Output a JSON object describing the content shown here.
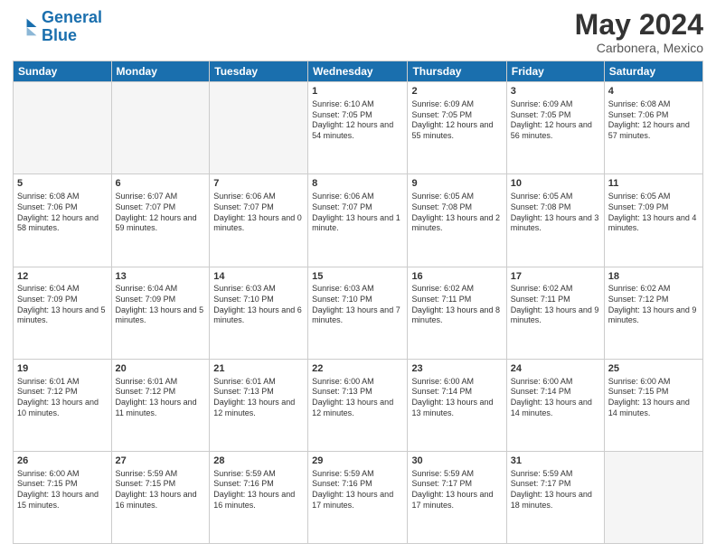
{
  "header": {
    "logo_general": "General",
    "logo_blue": "Blue",
    "month": "May 2024",
    "location": "Carbonera, Mexico"
  },
  "weekdays": [
    "Sunday",
    "Monday",
    "Tuesday",
    "Wednesday",
    "Thursday",
    "Friday",
    "Saturday"
  ],
  "weeks": [
    [
      {
        "day": "",
        "info": ""
      },
      {
        "day": "",
        "info": ""
      },
      {
        "day": "",
        "info": ""
      },
      {
        "day": "1",
        "info": "Sunrise: 6:10 AM\nSunset: 7:05 PM\nDaylight: 12 hours\nand 54 minutes."
      },
      {
        "day": "2",
        "info": "Sunrise: 6:09 AM\nSunset: 7:05 PM\nDaylight: 12 hours\nand 55 minutes."
      },
      {
        "day": "3",
        "info": "Sunrise: 6:09 AM\nSunset: 7:05 PM\nDaylight: 12 hours\nand 56 minutes."
      },
      {
        "day": "4",
        "info": "Sunrise: 6:08 AM\nSunset: 7:06 PM\nDaylight: 12 hours\nand 57 minutes."
      }
    ],
    [
      {
        "day": "5",
        "info": "Sunrise: 6:08 AM\nSunset: 7:06 PM\nDaylight: 12 hours\nand 58 minutes."
      },
      {
        "day": "6",
        "info": "Sunrise: 6:07 AM\nSunset: 7:07 PM\nDaylight: 12 hours\nand 59 minutes."
      },
      {
        "day": "7",
        "info": "Sunrise: 6:06 AM\nSunset: 7:07 PM\nDaylight: 13 hours\nand 0 minutes."
      },
      {
        "day": "8",
        "info": "Sunrise: 6:06 AM\nSunset: 7:07 PM\nDaylight: 13 hours\nand 1 minute."
      },
      {
        "day": "9",
        "info": "Sunrise: 6:05 AM\nSunset: 7:08 PM\nDaylight: 13 hours\nand 2 minutes."
      },
      {
        "day": "10",
        "info": "Sunrise: 6:05 AM\nSunset: 7:08 PM\nDaylight: 13 hours\nand 3 minutes."
      },
      {
        "day": "11",
        "info": "Sunrise: 6:05 AM\nSunset: 7:09 PM\nDaylight: 13 hours\nand 4 minutes."
      }
    ],
    [
      {
        "day": "12",
        "info": "Sunrise: 6:04 AM\nSunset: 7:09 PM\nDaylight: 13 hours\nand 5 minutes."
      },
      {
        "day": "13",
        "info": "Sunrise: 6:04 AM\nSunset: 7:09 PM\nDaylight: 13 hours\nand 5 minutes."
      },
      {
        "day": "14",
        "info": "Sunrise: 6:03 AM\nSunset: 7:10 PM\nDaylight: 13 hours\nand 6 minutes."
      },
      {
        "day": "15",
        "info": "Sunrise: 6:03 AM\nSunset: 7:10 PM\nDaylight: 13 hours\nand 7 minutes."
      },
      {
        "day": "16",
        "info": "Sunrise: 6:02 AM\nSunset: 7:11 PM\nDaylight: 13 hours\nand 8 minutes."
      },
      {
        "day": "17",
        "info": "Sunrise: 6:02 AM\nSunset: 7:11 PM\nDaylight: 13 hours\nand 9 minutes."
      },
      {
        "day": "18",
        "info": "Sunrise: 6:02 AM\nSunset: 7:12 PM\nDaylight: 13 hours\nand 9 minutes."
      }
    ],
    [
      {
        "day": "19",
        "info": "Sunrise: 6:01 AM\nSunset: 7:12 PM\nDaylight: 13 hours\nand 10 minutes."
      },
      {
        "day": "20",
        "info": "Sunrise: 6:01 AM\nSunset: 7:12 PM\nDaylight: 13 hours\nand 11 minutes."
      },
      {
        "day": "21",
        "info": "Sunrise: 6:01 AM\nSunset: 7:13 PM\nDaylight: 13 hours\nand 12 minutes."
      },
      {
        "day": "22",
        "info": "Sunrise: 6:00 AM\nSunset: 7:13 PM\nDaylight: 13 hours\nand 12 minutes."
      },
      {
        "day": "23",
        "info": "Sunrise: 6:00 AM\nSunset: 7:14 PM\nDaylight: 13 hours\nand 13 minutes."
      },
      {
        "day": "24",
        "info": "Sunrise: 6:00 AM\nSunset: 7:14 PM\nDaylight: 13 hours\nand 14 minutes."
      },
      {
        "day": "25",
        "info": "Sunrise: 6:00 AM\nSunset: 7:15 PM\nDaylight: 13 hours\nand 14 minutes."
      }
    ],
    [
      {
        "day": "26",
        "info": "Sunrise: 6:00 AM\nSunset: 7:15 PM\nDaylight: 13 hours\nand 15 minutes."
      },
      {
        "day": "27",
        "info": "Sunrise: 5:59 AM\nSunset: 7:15 PM\nDaylight: 13 hours\nand 16 minutes."
      },
      {
        "day": "28",
        "info": "Sunrise: 5:59 AM\nSunset: 7:16 PM\nDaylight: 13 hours\nand 16 minutes."
      },
      {
        "day": "29",
        "info": "Sunrise: 5:59 AM\nSunset: 7:16 PM\nDaylight: 13 hours\nand 17 minutes."
      },
      {
        "day": "30",
        "info": "Sunrise: 5:59 AM\nSunset: 7:17 PM\nDaylight: 13 hours\nand 17 minutes."
      },
      {
        "day": "31",
        "info": "Sunrise: 5:59 AM\nSunset: 7:17 PM\nDaylight: 13 hours\nand 18 minutes."
      },
      {
        "day": "",
        "info": ""
      }
    ]
  ]
}
